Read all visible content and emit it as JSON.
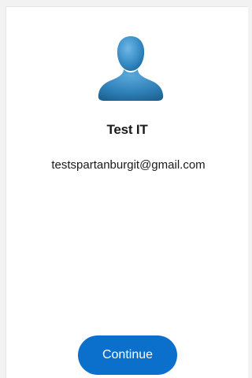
{
  "account": {
    "avatar_icon": "user-silhouette-icon",
    "display_name": "Test IT",
    "email": "testspartanburgit@gmail.com"
  },
  "actions": {
    "continue_label": "Continue"
  },
  "colors": {
    "primary": "#0b6fcc",
    "avatar": "#2f87c0"
  }
}
